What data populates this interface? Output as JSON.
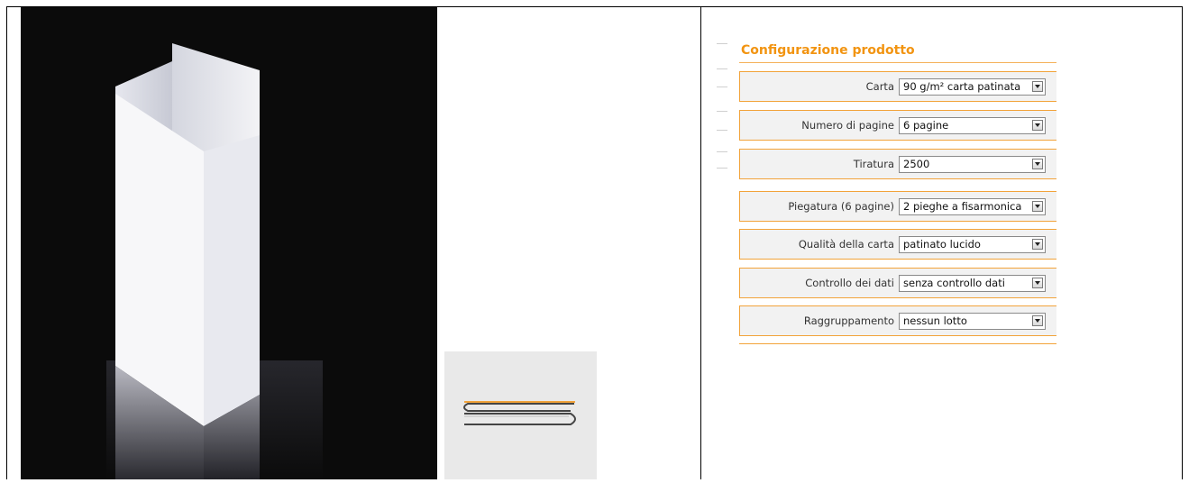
{
  "config": {
    "title": "Configurazione prodotto",
    "rows": [
      {
        "label": "Carta",
        "value": "90 g/m² carta patinata"
      },
      {
        "label": "Numero di pagine",
        "value": "6 pagine"
      },
      {
        "label": "Tiratura",
        "value": "2500"
      },
      {
        "label": "Piegatura (6 pagine)",
        "value": "2 pieghe a fisarmonica"
      },
      {
        "label": "Qualità della carta",
        "value": "patinato lucido"
      },
      {
        "label": "Controllo dei dati",
        "value": "senza controllo dati"
      },
      {
        "label": "Raggruppamento",
        "value": "nessun lotto"
      }
    ]
  },
  "icons": {
    "product": "folded-leaflet-image",
    "fold": "accordion-fold-diagram-icon",
    "dropdown": "chevron-down-icon"
  },
  "colors": {
    "accent": "#f29411",
    "row_border": "#f2a33a",
    "row_bg": "#f2f2f2",
    "photo_bg": "#0b0b0b"
  }
}
